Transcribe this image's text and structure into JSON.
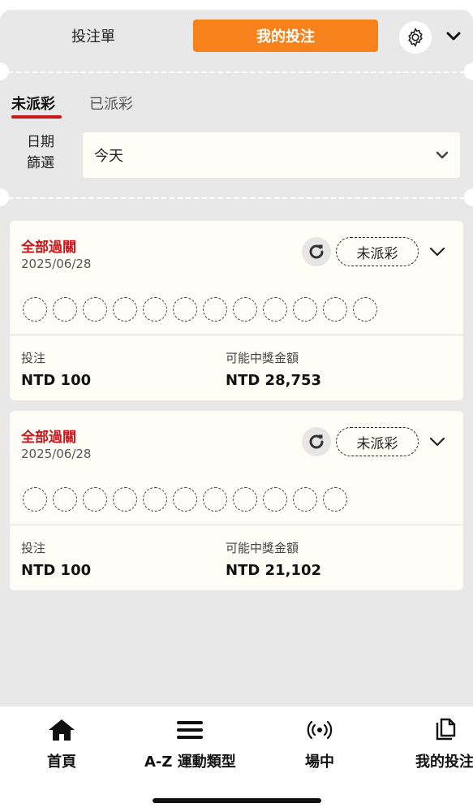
{
  "header": {
    "tab_betslip": "投注單",
    "tab_my_bets": "我的投注"
  },
  "sub_tabs": {
    "unsettled": "未派彩",
    "settled": "已派彩"
  },
  "date_filter": {
    "label": "日期\n篩選",
    "selected": "今天"
  },
  "bets": [
    {
      "title": "全部過關",
      "date": "2025/06/28",
      "status": "未派彩",
      "selection_count": 12,
      "stake_label": "投注",
      "stake_value": "NTD 100",
      "payout_label": "可能中獎金額",
      "payout_value": "NTD 28,753"
    },
    {
      "title": "全部過關",
      "date": "2025/06/28",
      "status": "未派彩",
      "selection_count": 11,
      "stake_label": "投注",
      "stake_value": "NTD 100",
      "payout_label": "可能中獎金額",
      "payout_value": "NTD 21,102"
    }
  ],
  "bottom_nav": {
    "items": [
      {
        "label": "首頁",
        "icon": "home-icon"
      },
      {
        "label": "A-Z 運動類型",
        "icon": "menu-icon"
      },
      {
        "label": "場中",
        "icon": "live-icon"
      },
      {
        "label": "我的投注",
        "icon": "copy-icon"
      }
    ]
  },
  "colors": {
    "accent_orange": "#f7821b",
    "accent_red": "#c8161d",
    "panel_bg": "#e8e8e8",
    "card_bg": "#fffdf5"
  }
}
